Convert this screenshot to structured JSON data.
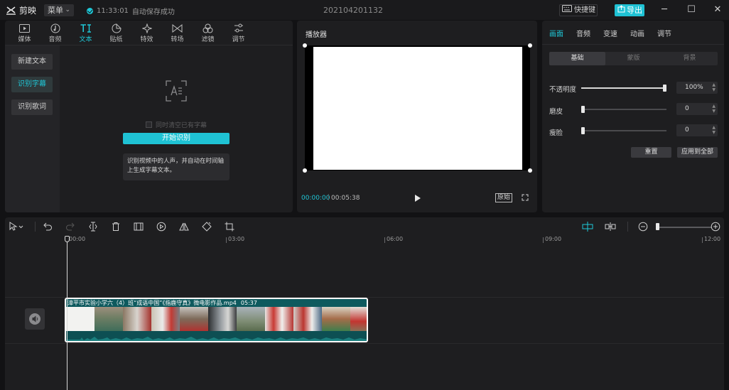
{
  "app": {
    "name": "剪映",
    "menu_label": "菜单",
    "save_time": "11:33:01",
    "save_text": "自动保存成功",
    "project_name": "202104201132",
    "shortcut_label": "快捷键",
    "export_label": "导出",
    "accent_color": "#1fc8d8"
  },
  "left_panel": {
    "tabs": [
      {
        "label": "媒体",
        "icon": "media-icon"
      },
      {
        "label": "音频",
        "icon": "audio-icon"
      },
      {
        "label": "文本",
        "icon": "text-icon",
        "active": true
      },
      {
        "label": "贴纸",
        "icon": "sticker-icon"
      },
      {
        "label": "特效",
        "icon": "effects-icon"
      },
      {
        "label": "转场",
        "icon": "transition-icon"
      },
      {
        "label": "滤镜",
        "icon": "filter-icon"
      },
      {
        "label": "调节",
        "icon": "adjust-icon"
      }
    ],
    "sidebar": [
      {
        "label": "新建文本"
      },
      {
        "label": "识别字幕",
        "active": true
      },
      {
        "label": "识别歌词"
      }
    ],
    "clear_existing_label": "同时清空已有字幕",
    "start_button": "开始识别",
    "description": "识别视频中的人声，并自动在时间轴上生成字幕文本。"
  },
  "player": {
    "title": "播放器",
    "current_time": "00:00:00",
    "total_time": "00:05:38",
    "ratio_button": "原始"
  },
  "right_panel": {
    "tabs": [
      {
        "label": "画面",
        "active": true
      },
      {
        "label": "音频"
      },
      {
        "label": "变速"
      },
      {
        "label": "动画"
      },
      {
        "label": "调节"
      }
    ],
    "subtabs": [
      {
        "label": "基础",
        "active": true
      },
      {
        "label": "蒙版"
      },
      {
        "label": "背景"
      }
    ],
    "properties": [
      {
        "label": "不透明度",
        "value": "100%",
        "level": 1.0
      },
      {
        "label": "磨皮",
        "value": "0",
        "level": 0.0
      },
      {
        "label": "瘦脸",
        "value": "0",
        "level": 0.0
      }
    ],
    "reset_button": "重置",
    "apply_all_button": "应用到全部"
  },
  "timeline": {
    "ruler": [
      "00:00",
      "03:00",
      "06:00",
      "09:00",
      "12:00"
    ],
    "clip": {
      "name": "漳平市实验小学六（4）班“成语中国”《指鹿守真》微电影作品.mp4",
      "duration": "05:37"
    }
  }
}
